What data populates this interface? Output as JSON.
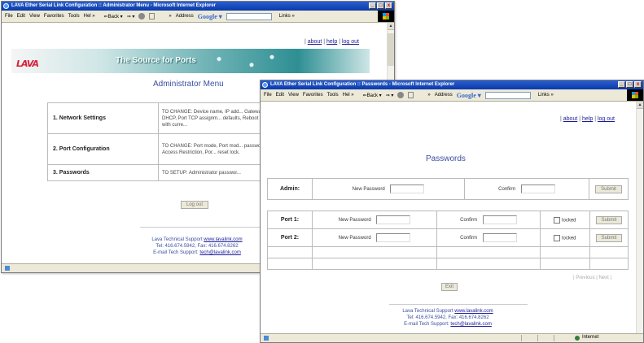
{
  "window1": {
    "title": "LAVA Ether Serial Link Configuration :: Administrator Menu - Microsoft Internet Explorer",
    "toolbar": {
      "menu": [
        "File",
        "Edit",
        "View",
        "Favorites",
        "Tools",
        "Hel »"
      ],
      "back": "⇐Back ▾",
      "forward": "⇒ ▾",
      "links_sep": "»",
      "address": "Address",
      "google": "Google ▾",
      "links": "Links »"
    },
    "nav_links": [
      "about",
      "help",
      "log out"
    ],
    "banner_slogan": "The Source for Ports",
    "logo_text": "LAVA",
    "heading": "Administrator Menu",
    "menu_rows": [
      {
        "name": "1. Network Settings",
        "desc": "TO CHANGE: Device name, IP add... Gateway, DHCP, Port TCP assignm... defaults, Reboot device with curre..."
      },
      {
        "name": "2. Port Configuration",
        "desc": "TO CHANGE: Port mode, Port mod... passwords, Access Restriction, Por... reset lock."
      },
      {
        "name": "3. Passwords",
        "desc": "TO SETUP: Administrator passwor..."
      }
    ],
    "logout_button": "Log out",
    "footer": {
      "line1_prefix": "Lava Technical Support",
      "line1_link": "www.lavalink.com",
      "line2": "Tel: 416.674.5942, Fax: 416.674.8262",
      "line3_prefix": "E-mail Tech Support:",
      "line3_link": "tech@lavalink.com"
    }
  },
  "window2": {
    "title": "LAVA Ether Serial Link Configuration :: Passwords - Microsoft Internet Explorer",
    "toolbar": {
      "menu": [
        "File",
        "Edit",
        "View",
        "Favorites",
        "Tools",
        "Hel »"
      ],
      "back": "⇐Back ▾",
      "forward": "⇒ ▾",
      "links_sep": "»",
      "address": "Address",
      "google": "Google ▾",
      "links": "Links »"
    },
    "nav_links": [
      "about",
      "help",
      "log out"
    ],
    "heading": "Passwords",
    "admin": {
      "label": "Admin:",
      "new_password": "New Password",
      "confirm": "Confirm",
      "submit": "Submit"
    },
    "ports": [
      {
        "label": "Port 1:",
        "new_password": "New Password",
        "confirm": "Confirm",
        "locked": "locked",
        "submit": "Submit"
      },
      {
        "label": "Port 2:",
        "new_password": "New Password",
        "confirm": "Confirm",
        "locked": "locked",
        "submit": "Submit"
      }
    ],
    "pagination": "| Previous | Next |",
    "exit_button": "Exit",
    "footer": {
      "line1_prefix": "Lava Technical Support",
      "line1_link": "www.lavalink.com",
      "line2": "Tel: 416.674.5942, Fax: 416.674.8262",
      "line3_prefix": "E-mail Tech Support:",
      "line3_link": "tech@lavalink.com"
    },
    "status_zone": "Internet"
  },
  "colors": {
    "title_bar": "#0a3aa8",
    "logo_red": "#d6203a",
    "banner_teal": "#2e8f93",
    "heading_blue": "#3c4fa0",
    "link": "#1b1b9a"
  }
}
